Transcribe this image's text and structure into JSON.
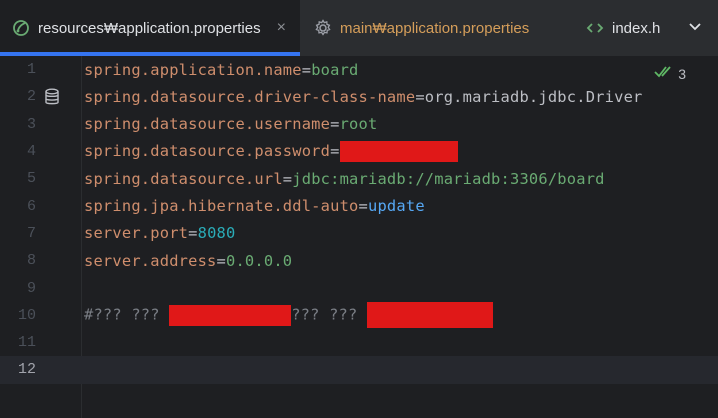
{
  "tabs": [
    {
      "label": "resources₩application.properties",
      "icon": "spring-config-icon",
      "active": true
    },
    {
      "label": "main₩application.properties",
      "icon": "gear-icon",
      "active": false
    },
    {
      "label": "index.h",
      "icon": "html-icon",
      "active": false
    }
  ],
  "tab_close": "×",
  "overflow_icon": "chevron-down-icon",
  "inspection": {
    "count": "3"
  },
  "lines": [
    {
      "n": "1",
      "key": "spring.application.name",
      "eq": "=",
      "val": "board"
    },
    {
      "n": "2",
      "key": "spring.datasource.driver-class-name",
      "eq": "=",
      "val": "org.mariadb.jdbc.Driver"
    },
    {
      "n": "3",
      "key": "spring.datasource.username",
      "eq": "=",
      "val": "root"
    },
    {
      "n": "4",
      "key": "spring.datasource.password",
      "eq": "=",
      "val": ""
    },
    {
      "n": "5",
      "key": "spring.datasource.url",
      "eq": "=",
      "val": "jdbc:mariadb://mariadb:3306/board"
    },
    {
      "n": "6",
      "key": "spring.jpa.hibernate.ddl-auto",
      "eq": "=",
      "val": "update"
    },
    {
      "n": "7",
      "key": "server.port",
      "eq": "=",
      "val": "8080"
    },
    {
      "n": "8",
      "key": "server.address",
      "eq": "=",
      "val": "0.0.0.0"
    },
    {
      "n": "9"
    },
    {
      "n": "10",
      "comment_a": "#??? ??? ",
      "comment_b": "??? ??? "
    },
    {
      "n": "11"
    },
    {
      "n": "12"
    }
  ],
  "colors": {
    "accent": "#3574f0",
    "redaction": "#e01818"
  }
}
